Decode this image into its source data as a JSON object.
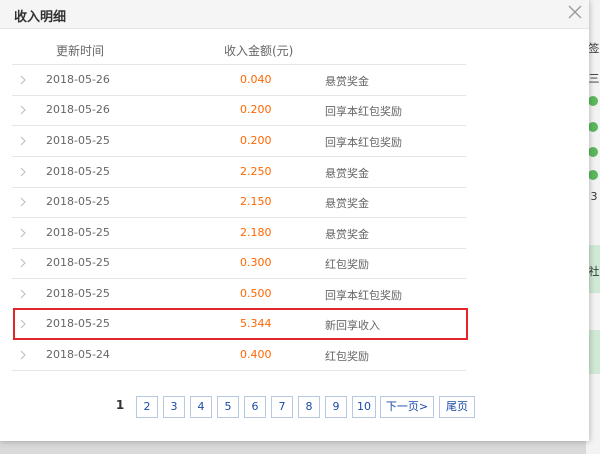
{
  "dialog": {
    "title": "收入明细",
    "close_icon": "close-icon"
  },
  "columns": {
    "time": "更新时间",
    "amount": "收入金额(元)"
  },
  "rows": [
    {
      "date": "2018-05-26",
      "amount": "0.040",
      "desc": "悬赏奖金"
    },
    {
      "date": "2018-05-26",
      "amount": "0.200",
      "desc": "回享本红包奖励"
    },
    {
      "date": "2018-05-25",
      "amount": "0.200",
      "desc": "回享本红包奖励"
    },
    {
      "date": "2018-05-25",
      "amount": "2.250",
      "desc": "悬赏奖金"
    },
    {
      "date": "2018-05-25",
      "amount": "2.150",
      "desc": "悬赏奖金"
    },
    {
      "date": "2018-05-25",
      "amount": "2.180",
      "desc": "悬赏奖金"
    },
    {
      "date": "2018-05-25",
      "amount": "0.300",
      "desc": "红包奖励"
    },
    {
      "date": "2018-05-25",
      "amount": "0.500",
      "desc": "回享本红包奖励"
    },
    {
      "date": "2018-05-25",
      "amount": "5.344",
      "desc": "新回享收入"
    },
    {
      "date": "2018-05-24",
      "amount": "0.400",
      "desc": "红包奖励"
    }
  ],
  "pagination": {
    "current": "1",
    "pages": [
      "2",
      "3",
      "4",
      "5",
      "6",
      "7",
      "8",
      "9",
      "10"
    ],
    "next": "下一页>",
    "last": "尾页"
  },
  "background": {
    "side_text_1": "签",
    "side_text_2": "三",
    "side_text_3": "3",
    "side_text_4": "社"
  },
  "colors": {
    "amount": "#ff6600",
    "highlight_border": "#e0262b",
    "link": "#1a4aa8"
  }
}
